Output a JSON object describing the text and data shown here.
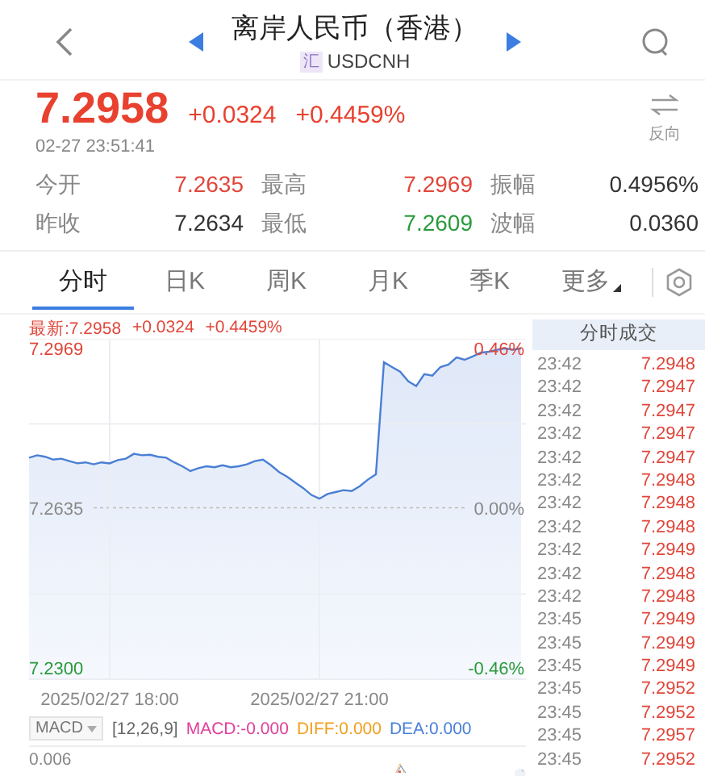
{
  "header": {
    "title": "离岸人民币（香港）",
    "badge": "汇",
    "symbol": "USDCNH"
  },
  "quote": {
    "price": "7.2958",
    "change": "+0.0324",
    "change_pct": "+0.4459%",
    "time": "02-27 23:51:41",
    "reverse_label": "反向"
  },
  "stats": [
    {
      "label": "今开",
      "value": "7.2635",
      "color": "#e0463a"
    },
    {
      "label": "最高",
      "value": "7.2969",
      "color": "#e0463a"
    },
    {
      "label": "振幅",
      "value": "0.4956%",
      "color": "#333333"
    },
    {
      "label": "昨收",
      "value": "7.2634",
      "color": "#333333"
    },
    {
      "label": "最低",
      "value": "7.2609",
      "color": "#2a9a3c"
    },
    {
      "label": "波幅",
      "value": "0.0360",
      "color": "#333333"
    }
  ],
  "tabs": [
    {
      "label": "分时",
      "selected": true,
      "kind": "plain"
    },
    {
      "label": "日K",
      "selected": false,
      "kind": "plain"
    },
    {
      "label": "周K",
      "selected": false,
      "kind": "plain"
    },
    {
      "label": "月K",
      "selected": false,
      "kind": "plain"
    },
    {
      "label": "季K",
      "selected": false,
      "kind": "plain"
    },
    {
      "label": "更多",
      "selected": false,
      "kind": "dropdown"
    }
  ],
  "intraday": {
    "latest": "最新:7.2958",
    "change": "+0.0324",
    "change_pct": "+0.4459%",
    "pct_labels": [
      "0.46%",
      "0.00%",
      "-0.46%"
    ],
    "chart_data": {
      "type": "line",
      "categories": [
        null,
        null,
        null,
        null,
        null,
        null,
        null,
        null,
        null,
        null,
        "2025/02/27 18:00",
        null,
        null,
        null,
        null,
        null,
        null,
        null,
        null,
        null,
        null,
        null,
        null,
        null,
        null,
        null,
        null,
        null,
        null,
        null,
        null,
        null,
        null,
        null,
        null,
        null,
        "2025/02/27 21:00",
        null,
        null,
        null,
        null,
        null,
        null,
        null,
        null,
        null,
        null,
        null,
        null,
        null,
        null,
        null,
        null,
        null,
        null,
        null,
        null,
        null,
        null,
        null,
        null,
        null
      ],
      "ylim": [
        7.2276,
        7.2989
      ],
      "yticks": [
        {
          "value": 7.2969,
          "label": "7.2969"
        },
        {
          "value": 7.2635,
          "label": "7.2635"
        },
        {
          "value": 7.23,
          "label": "7.2300"
        }
      ],
      "values": [
        7.274,
        7.2745,
        7.2742,
        7.2736,
        7.2738,
        7.2733,
        7.2728,
        7.273,
        7.2726,
        7.273,
        7.2728,
        7.2735,
        7.2738,
        7.2748,
        7.2745,
        7.2746,
        7.2742,
        7.274,
        7.273,
        7.2722,
        7.2712,
        7.2718,
        7.2722,
        7.272,
        7.2724,
        7.272,
        7.2722,
        7.2726,
        7.2733,
        7.2736,
        7.2724,
        7.271,
        7.27,
        7.2688,
        7.2676,
        7.2662,
        7.2654,
        7.2664,
        7.2668,
        7.2672,
        7.267,
        7.268,
        7.2694,
        7.2705,
        7.294,
        7.293,
        7.292,
        7.29,
        7.289,
        7.2915,
        7.2912,
        7.293,
        7.2935,
        7.295,
        7.2945,
        7.2952,
        7.296,
        7.2962,
        7.2966,
        7.2969,
        7.2966,
        7.2969
      ]
    }
  },
  "indicator": {
    "name": "MACD",
    "params": "[12,26,9]",
    "values": [
      {
        "text": "MACD:-0.000",
        "color": "#e0409a"
      },
      {
        "text": "DIFF:0.000",
        "color": "#f0a020"
      },
      {
        "text": "DEA:0.000",
        "color": "#4a80d8"
      }
    ],
    "axis_label": "0.006"
  },
  "trades": {
    "title": "分时成交",
    "rows": [
      {
        "time": "23:42",
        "price": "7.2948"
      },
      {
        "time": "23:42",
        "price": "7.2947"
      },
      {
        "time": "23:42",
        "price": "7.2947"
      },
      {
        "time": "23:42",
        "price": "7.2947"
      },
      {
        "time": "23:42",
        "price": "7.2947"
      },
      {
        "time": "23:42",
        "price": "7.2948"
      },
      {
        "time": "23:42",
        "price": "7.2948"
      },
      {
        "time": "23:42",
        "price": "7.2948"
      },
      {
        "time": "23:42",
        "price": "7.2949"
      },
      {
        "time": "23:42",
        "price": "7.2948"
      },
      {
        "time": "23:42",
        "price": "7.2948"
      },
      {
        "time": "23:45",
        "price": "7.2949"
      },
      {
        "time": "23:45",
        "price": "7.2949"
      },
      {
        "time": "23:45",
        "price": "7.2949"
      },
      {
        "time": "23:45",
        "price": "7.2952"
      },
      {
        "time": "23:45",
        "price": "7.2952"
      },
      {
        "time": "23:45",
        "price": "7.2957"
      },
      {
        "time": "23:45",
        "price": "7.2952"
      }
    ]
  }
}
